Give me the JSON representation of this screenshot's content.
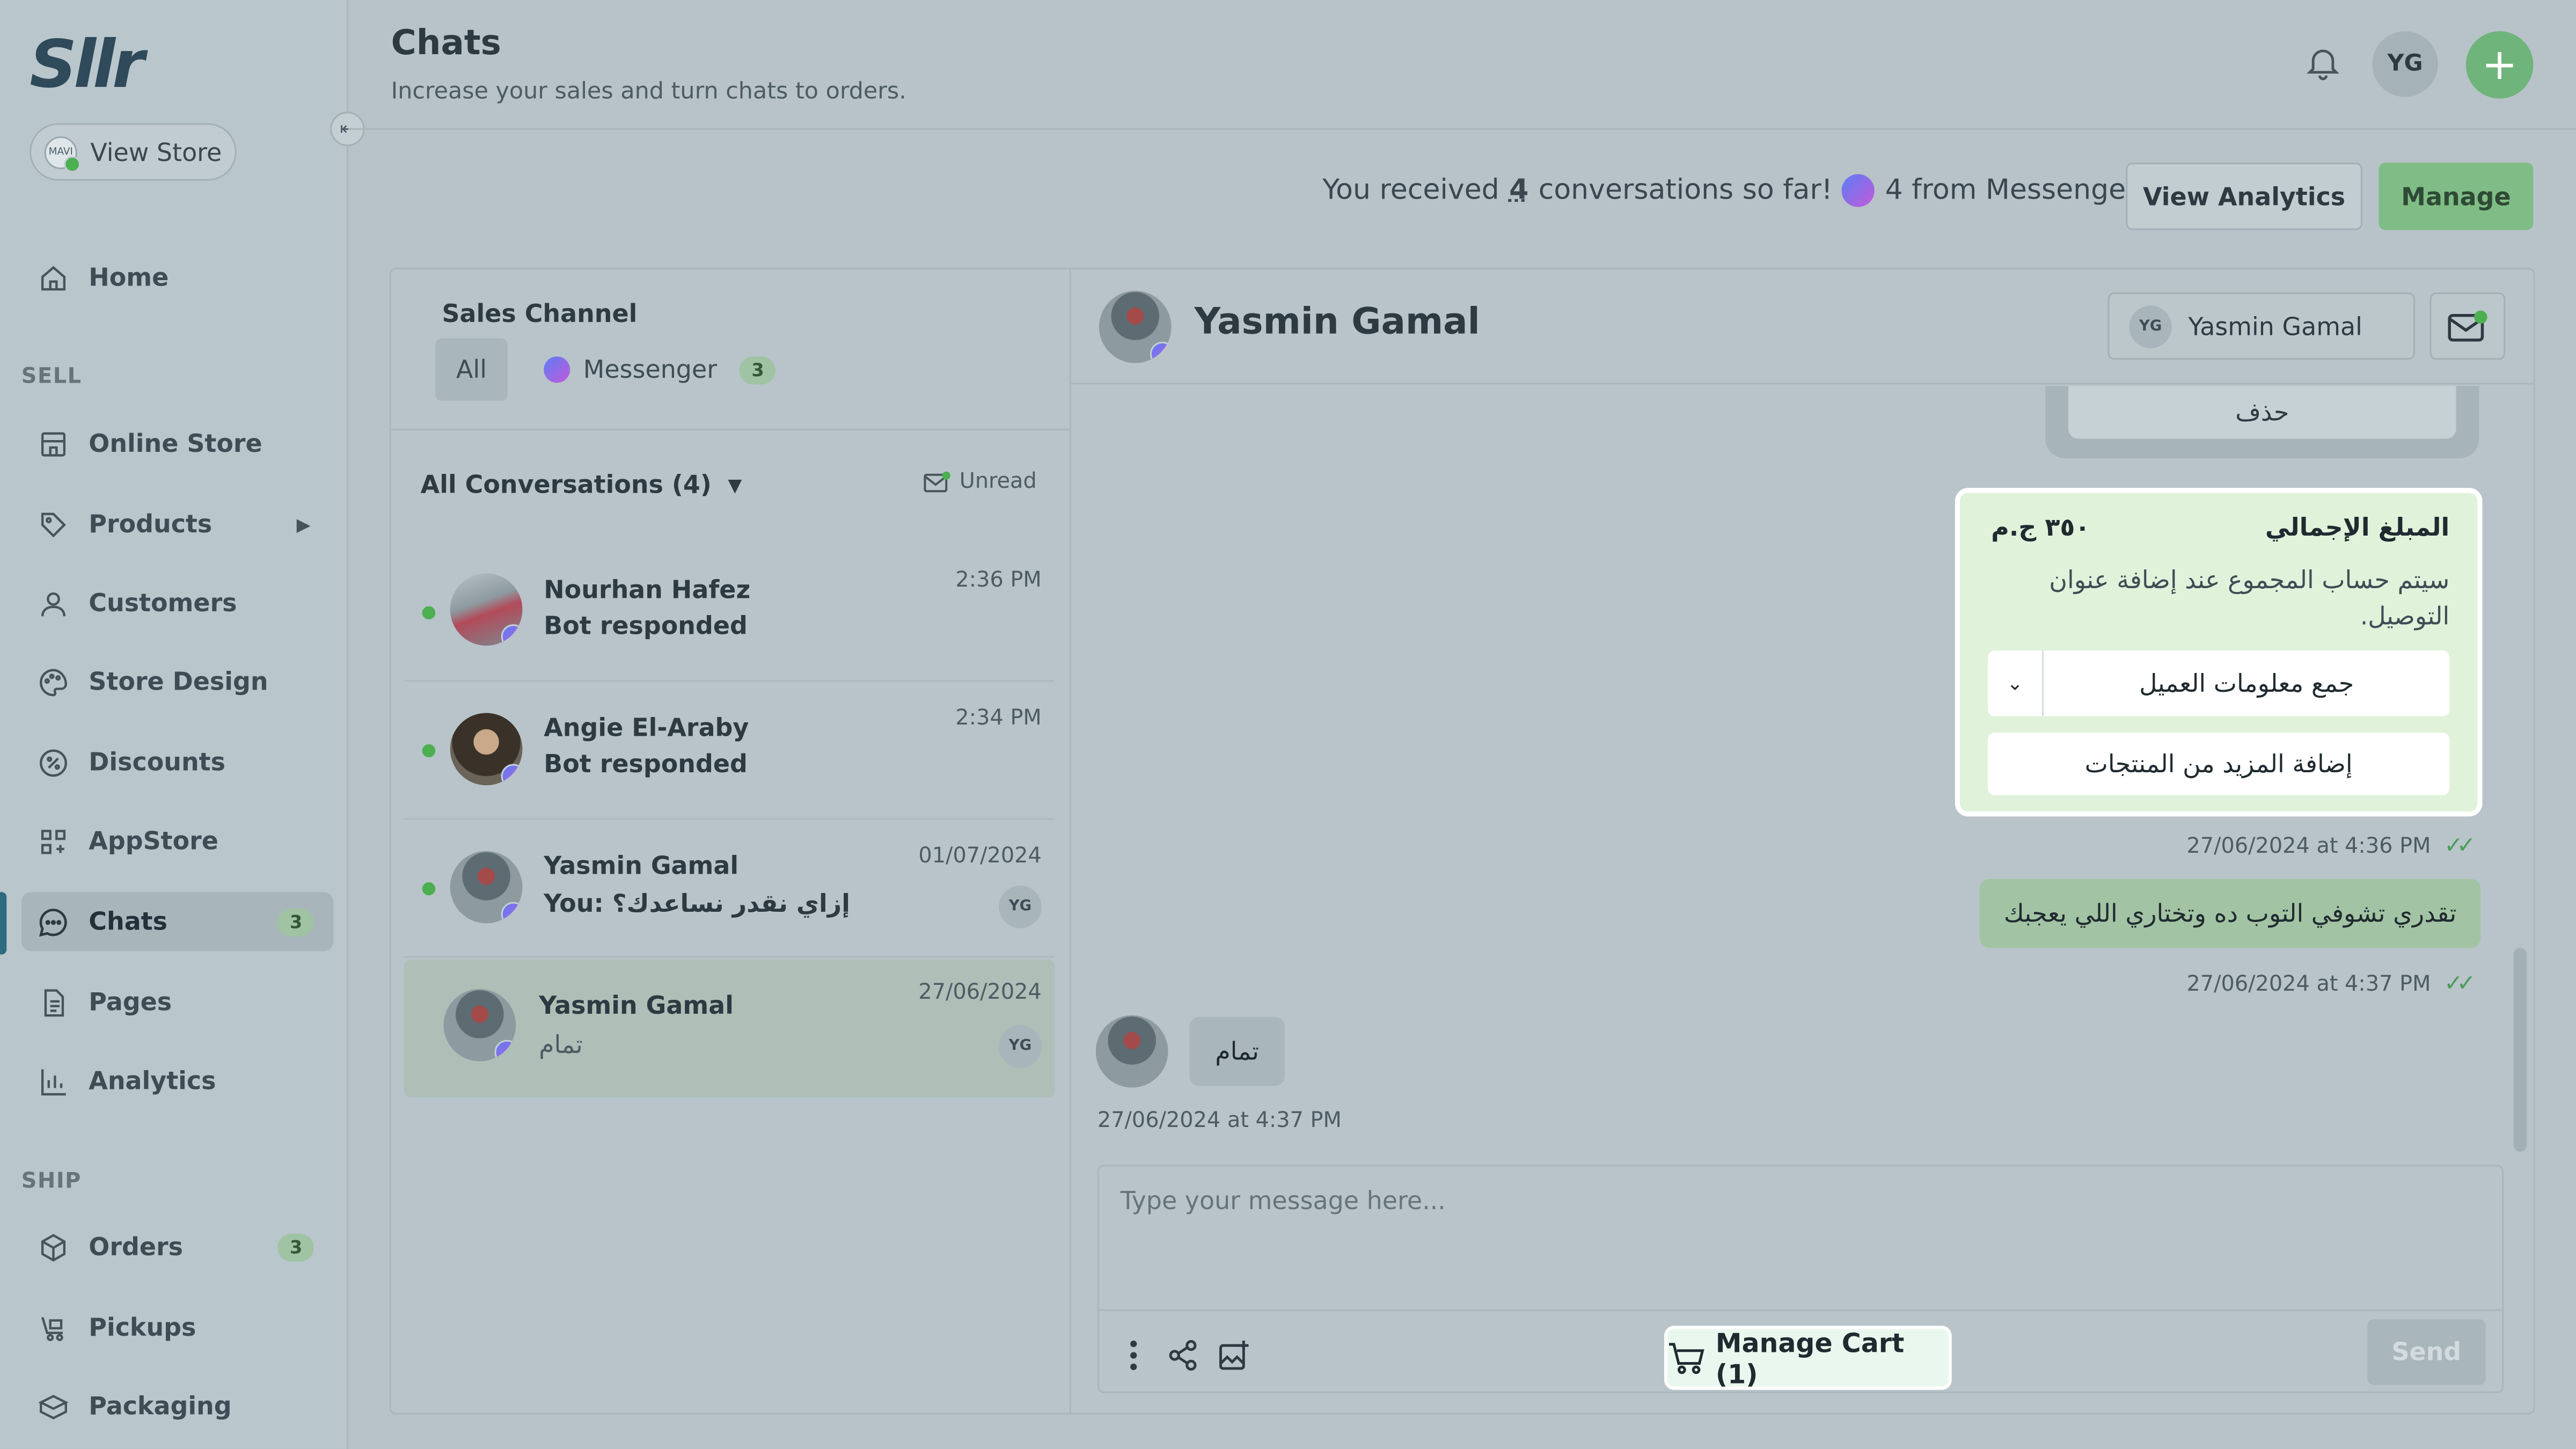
{
  "app": {
    "logo": "Sllr",
    "view_store": "View Store",
    "store_avatar_text": "MAVI"
  },
  "sidebar": {
    "sections": {
      "sell": "SELL",
      "ship": "SHIP"
    },
    "items": [
      {
        "label": "Home",
        "icon": "home-icon"
      },
      {
        "label": "Online Store",
        "icon": "store-icon"
      },
      {
        "label": "Products",
        "icon": "tag-icon",
        "has_arrow": true
      },
      {
        "label": "Customers",
        "icon": "user-icon"
      },
      {
        "label": "Store Design",
        "icon": "palette-icon"
      },
      {
        "label": "Discounts",
        "icon": "discount-icon"
      },
      {
        "label": "AppStore",
        "icon": "apps-icon"
      },
      {
        "label": "Chats",
        "icon": "chat-icon",
        "badge": "3",
        "active": true
      },
      {
        "label": "Pages",
        "icon": "page-icon"
      },
      {
        "label": "Analytics",
        "icon": "analytics-icon"
      },
      {
        "label": "Orders",
        "icon": "box-icon",
        "badge": "3"
      },
      {
        "label": "Pickups",
        "icon": "pickup-icon"
      },
      {
        "label": "Packaging",
        "icon": "package-icon"
      }
    ]
  },
  "header": {
    "title": "Chats",
    "subtitle": "Increase your sales and turn chats to orders.",
    "avatar": "YG"
  },
  "stats": {
    "prefix": "You received",
    "count": "4",
    "suffix": "conversations so far!",
    "messenger": "4 from Messenger",
    "analytics_button": "View Analytics",
    "manage_button": "Manage"
  },
  "channels": {
    "label": "Sales Channel",
    "all": "All",
    "messenger": "Messenger",
    "messenger_count": "3"
  },
  "conversations": {
    "filter": "All Conversations (4)",
    "unread": "Unread",
    "items": [
      {
        "name": "Nourhan Hafez",
        "message": "Bot responded",
        "time": "2:36 PM",
        "online": true
      },
      {
        "name": "Angie El-Araby",
        "message": "Bot responded",
        "time": "2:34 PM",
        "online": true
      },
      {
        "name": "Yasmin Gamal",
        "message": "You: إزاي نقدر نساعدك؟",
        "time": "01/07/2024",
        "online": true,
        "assignee": "YG"
      },
      {
        "name": "Yasmin Gamal",
        "message": "تمام",
        "time": "27/06/2024",
        "online": false,
        "assignee": "YG",
        "selected": true
      }
    ]
  },
  "chat": {
    "name": "Yasmin Gamal",
    "assignee_initials": "YG",
    "assignee_name": "Yasmin Gamal",
    "prev_button": "حذف",
    "cart": {
      "title": "المبلغ الإجمالي",
      "price": "٣٥٠ ج.م",
      "note": "سيتم حساب المجموع عند إضافة عنوان التوصيل.",
      "select_label": "جمع معلومات العميل",
      "add_more": "إضافة المزيد من المنتجات"
    },
    "stamp1": "27/06/2024 at 4:36 PM",
    "outgoing": "تقدري تشوفي التوب ده وتختاري اللي يعجبك",
    "stamp2": "27/06/2024 at 4:37 PM",
    "incoming": "تمام",
    "stamp3": "27/06/2024 at 4:37 PM",
    "placeholder": "Type your message here...",
    "manage_cart": "Manage Cart (1)",
    "send": "Send"
  },
  "colors": {
    "accent_green": "#80bd86",
    "online": "#4caf50",
    "cart_bg": "#e0f2da"
  }
}
